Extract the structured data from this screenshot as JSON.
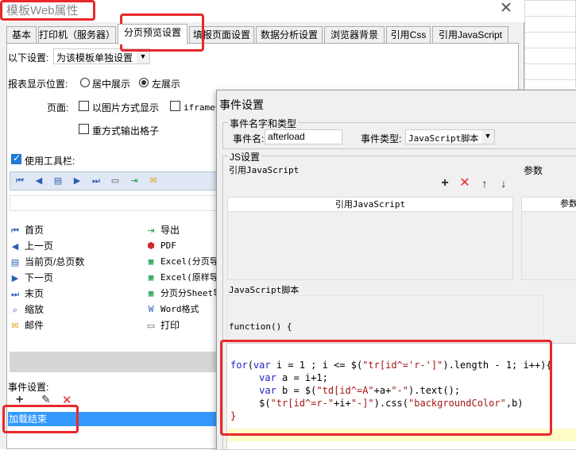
{
  "dialog": {
    "title": "模板Web属性",
    "close_glyph": "✕",
    "tabs": [
      "基本",
      "打印机（服务器）",
      "分页预览设置",
      "填报页面设置",
      "数据分析设置",
      "浏览器背景",
      "引用Css",
      "引用JavaScript"
    ],
    "active_tab": "分页预览设置"
  },
  "settings": {
    "scope_label": "以下设置:",
    "scope_value": "为该模板单独设置",
    "position_label": "报表显示位置:",
    "position_options": [
      "居中展示",
      "左展示"
    ],
    "position_selected": "左展示",
    "page_label": "页面:",
    "page_options": [
      "以图片方式显示",
      "iframe嵌",
      "重方式输出格子"
    ],
    "use_toolbar_label": "使用工具栏:",
    "use_toolbar_checked": true
  },
  "toolbar_icons": [
    "first-page-icon",
    "prev-page-icon",
    "page-count-icon",
    "next-page-icon",
    "last-page-icon",
    "print-icon",
    "export-icon",
    "mail-icon"
  ],
  "buttons": {
    "left": [
      {
        "icon": "first-page-icon",
        "label": "首页"
      },
      {
        "icon": "prev-page-icon",
        "label": "上一页"
      },
      {
        "icon": "page-count-icon",
        "label": "当前页/总页数"
      },
      {
        "icon": "next-page-icon",
        "label": "下一页"
      },
      {
        "icon": "last-page-icon",
        "label": "末页"
      },
      {
        "icon": "zoom-icon",
        "label": "缩放"
      },
      {
        "icon": "mail-icon",
        "label": "邮件"
      }
    ],
    "right": [
      {
        "icon": "export-icon",
        "label": "导出"
      },
      {
        "icon": "pdf-icon",
        "label": "PDF"
      },
      {
        "icon": "excel-icon",
        "label": "Excel(分页导"
      },
      {
        "icon": "excel-icon",
        "label": "Excel(原样导"
      },
      {
        "icon": "excel-icon",
        "label": "分页分Sheet导"
      },
      {
        "icon": "word-icon",
        "label": "Word格式"
      },
      {
        "icon": "print-icon",
        "label": "打印"
      }
    ]
  },
  "event_section": {
    "label": "事件设置:",
    "items": [
      "加载结束"
    ]
  },
  "event_dialog": {
    "title": "事件设置",
    "name_group_legend": "事件名字和类型",
    "name_label": "事件名:",
    "name_value": "afterload",
    "type_label": "事件类型:",
    "type_value": "JavaScript脚本",
    "js_group_legend": "JS设置",
    "ref_js_label": "引用JavaScript",
    "param_label": "参数",
    "ref_table_header": "引用JavaScript",
    "param_table_header": "参数",
    "script_label": "JavaScript脚本",
    "code_header": "function() {",
    "code_lines": [
      "for(var i = 1 ; i <= $(\"tr[id^='r-']\").length - 1; i++){",
      "     var a = i+1;",
      "     var b = $(\"td[id^=A\"+a+\"-\").text();",
      "     $(\"tr[id^=r-\"+i+\"-]\").css(\"backgroundColor\",b)",
      "}"
    ]
  },
  "colors": {
    "annotation_red": "#e8282b",
    "selection_blue": "#3399ff",
    "keyword_blue": "#2020c8",
    "string_red": "#a31515"
  }
}
